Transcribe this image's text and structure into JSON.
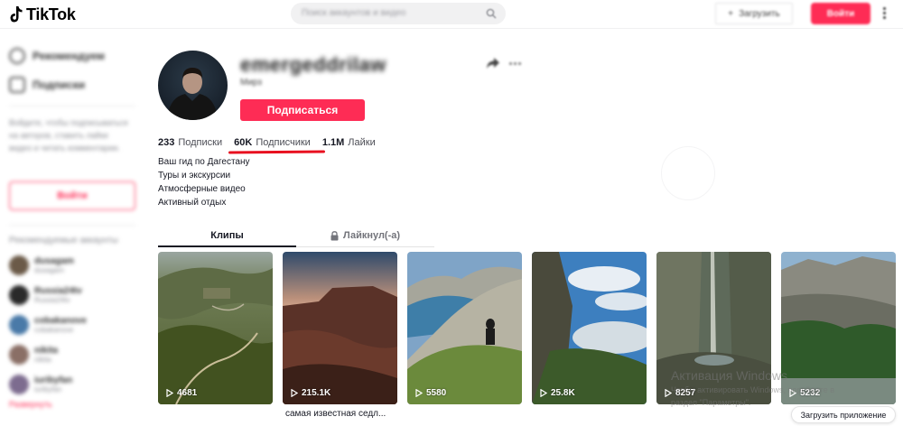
{
  "header": {
    "logo_text": "TikTok",
    "search_placeholder": "Поиск аккаунтов и видео",
    "upload_label": "Загрузить",
    "login_label": "Войти"
  },
  "sidebar": {
    "nav": [
      {
        "label": "Рекомендуем",
        "icon": "home-icon"
      },
      {
        "label": "Подписки",
        "icon": "following-icon"
      }
    ],
    "login_prompt": "Войдите, чтобы подписываться на авторов, ставить лайки видео и читать комментарии.",
    "login_button": "Войти",
    "suggested_heading": "Рекомендуемые аккаунты",
    "accounts": [
      {
        "name": "dusagam",
        "sub": "dusagam"
      },
      {
        "name": "Russia24tv",
        "sub": "Russia24tv"
      },
      {
        "name": "cobakanove",
        "sub": "cobakanove"
      },
      {
        "name": "nikita",
        "sub": "nikita"
      },
      {
        "name": "iuribyfan",
        "sub": "iuribyfan"
      }
    ],
    "see_all": "Развернуть"
  },
  "profile": {
    "username": "emergeddrilaw",
    "nickname": "Мирз",
    "follow_button": "Подписаться",
    "stats": [
      {
        "value": "233",
        "label": "Подписки"
      },
      {
        "value": "60K",
        "label": "Подписчики"
      },
      {
        "value": "1.1M",
        "label": "Лайки"
      }
    ],
    "bio": [
      "Ваш гид по Дагестану",
      "Туры и экскурсии",
      "Атмосферные видео",
      "Активный отдых"
    ]
  },
  "tabs": [
    {
      "label": "Клипы",
      "icon": ""
    },
    {
      "label": "Лайкнул(-а)",
      "icon": "lock-icon"
    }
  ],
  "videos": [
    {
      "views": "4681",
      "caption": ""
    },
    {
      "views": "215.1K",
      "caption": "самая известная седл..."
    },
    {
      "views": "5580",
      "caption": ""
    },
    {
      "views": "25.8K",
      "caption": ""
    },
    {
      "views": "8257",
      "caption": ""
    },
    {
      "views": "5232",
      "caption": ""
    }
  ],
  "watermark": {
    "title": "Активация Windows",
    "line1": "Чтобы активировать Windows, перейдите в",
    "line2": "раздел \"Параметры\"."
  },
  "get_app": "Загрузить приложение",
  "colors": {
    "accent": "#fe2c55",
    "highlight_underline": "#e8101f"
  }
}
